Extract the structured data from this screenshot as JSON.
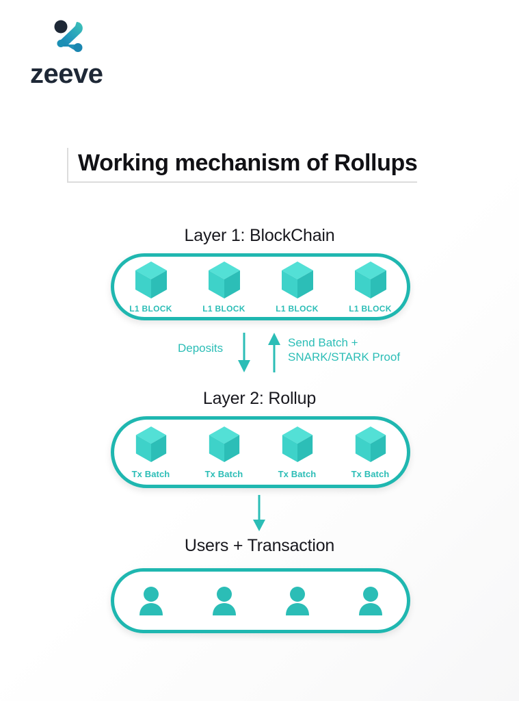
{
  "brand": {
    "wordmark": "zeeve",
    "logo_icon": "zeeve-logo-mark",
    "logo_dark_color": "#1e2836",
    "logo_gradient_from": "#3fc4b8",
    "logo_gradient_to": "#1479a8"
  },
  "title": "Working mechanism of Rollups",
  "colors": {
    "teal": "#1fb7b0",
    "teal_text": "#2bbdb6",
    "cube_top": "#4fded5",
    "cube_left": "#3fd0c8",
    "cube_right": "#2bbdb6",
    "heading_text": "#18181e",
    "background": "#ffffff"
  },
  "layers": [
    {
      "id": "layer1",
      "heading": "Layer 1: BlockChain",
      "item_icon": "cube-icon",
      "items": [
        {
          "label": "L1 BLOCK"
        },
        {
          "label": "L1 BLOCK"
        },
        {
          "label": "L1 BLOCK"
        },
        {
          "label": "L1 BLOCK"
        }
      ]
    },
    {
      "id": "layer2",
      "heading": "Layer 2: Rollup",
      "item_icon": "cube-icon",
      "items": [
        {
          "label": "Tx Batch"
        },
        {
          "label": "Tx Batch"
        },
        {
          "label": "Tx Batch"
        },
        {
          "label": "Tx Batch"
        }
      ]
    },
    {
      "id": "users",
      "heading": "Users + Transaction",
      "item_icon": "person-icon",
      "items": [
        {
          "label": ""
        },
        {
          "label": ""
        },
        {
          "label": ""
        },
        {
          "label": ""
        }
      ]
    }
  ],
  "flows": {
    "deposits": {
      "label": "Deposits",
      "direction": "down",
      "icon": "arrow-down-icon"
    },
    "send_batch": {
      "label_line1": "Send Batch +",
      "label_line2": "SNARK/STARK Proof",
      "direction": "up",
      "icon": "arrow-up-icon"
    },
    "to_users": {
      "label": "",
      "direction": "down",
      "icon": "arrow-down-icon"
    }
  }
}
